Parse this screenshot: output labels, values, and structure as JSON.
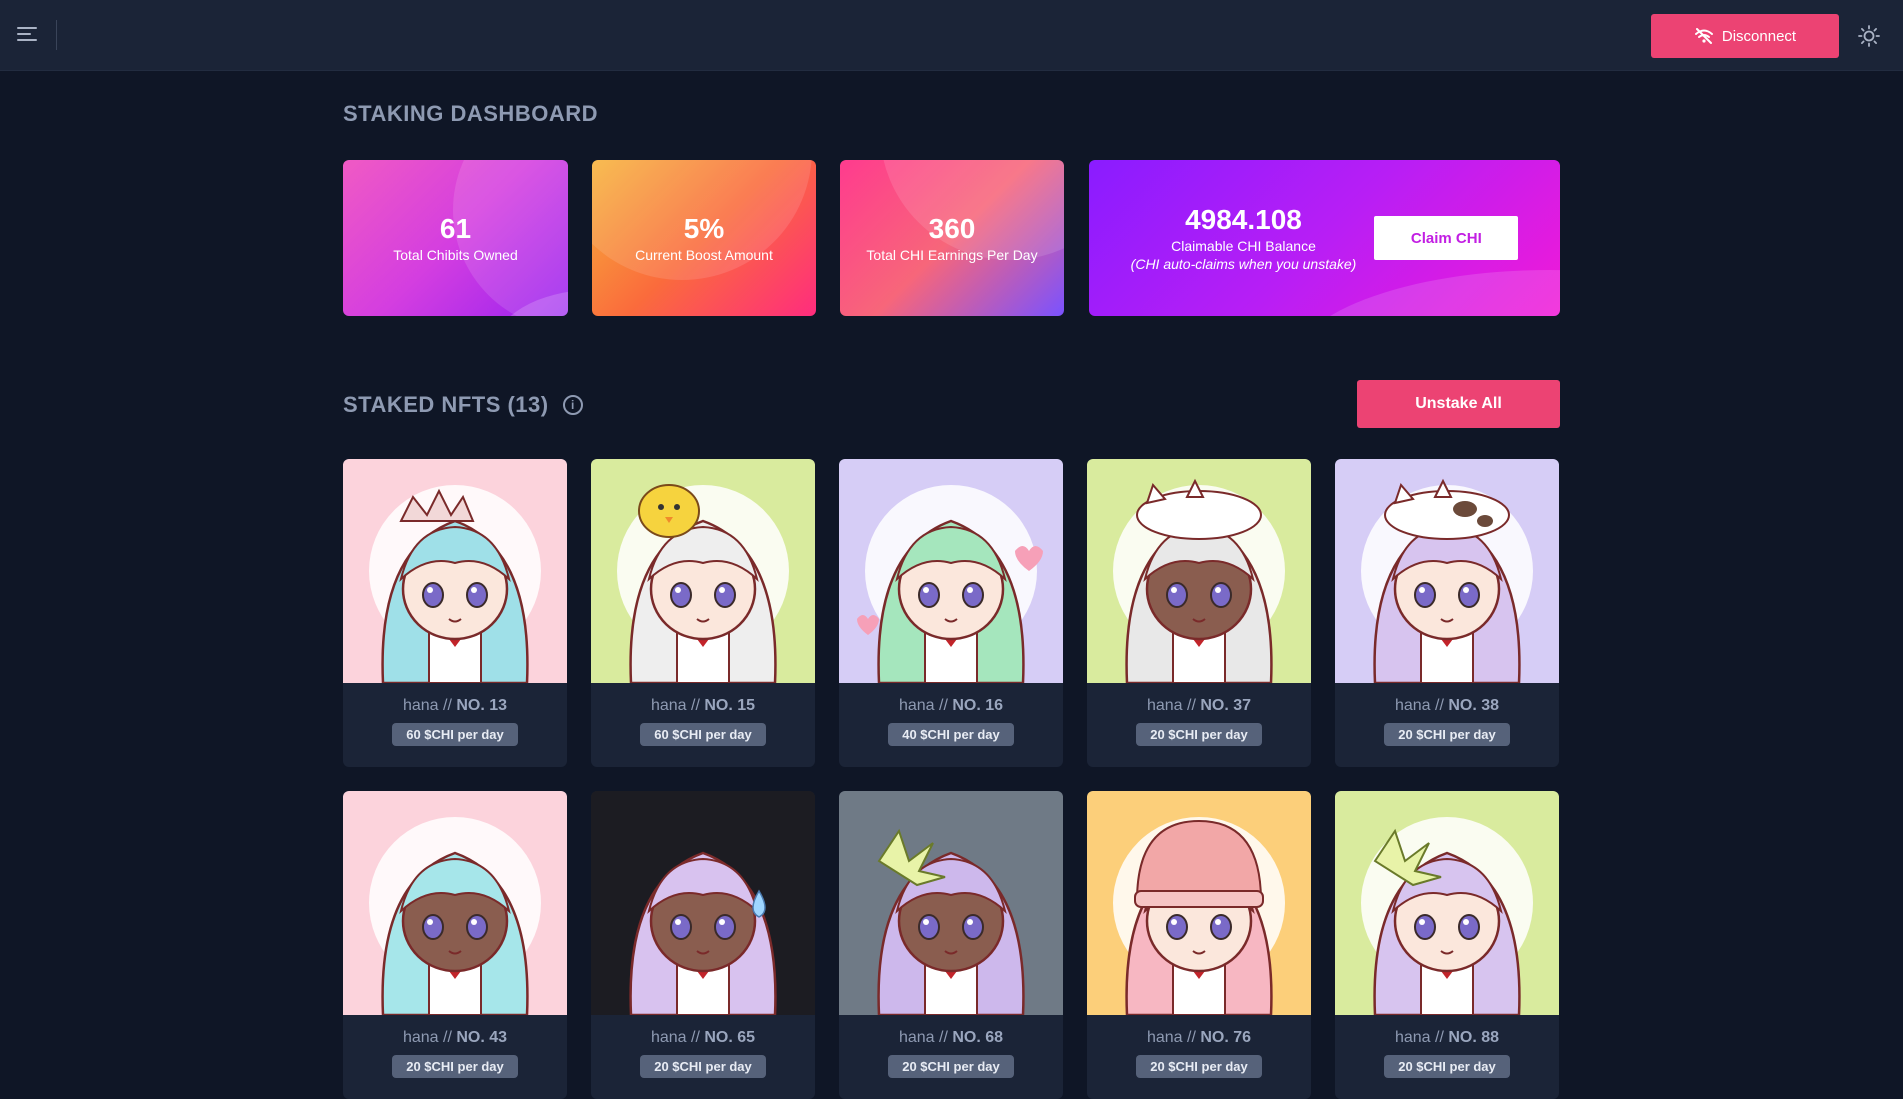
{
  "header": {
    "disconnect_label": "Disconnect",
    "accent": "#ec4373"
  },
  "dashboard": {
    "title": "STAKING DASHBOARD",
    "stats": [
      {
        "value": "61",
        "label": "Total Chibits Owned"
      },
      {
        "value": "5%",
        "label": "Current Boost Amount"
      },
      {
        "value": "360",
        "label": "Total CHI Earnings Per Day"
      }
    ],
    "claim": {
      "value": "4984.108",
      "label": "Claimable CHI Balance",
      "note": "(CHI auto-claims when you unstake)",
      "button": "Claim CHI"
    }
  },
  "staked": {
    "title": "STAKED NFTS (13)",
    "unstake_all": "Unstake All",
    "items": [
      {
        "prefix": "hana //",
        "number": "NO. 13",
        "rate": "60 $CHI per day",
        "bg": "#fcd3dc",
        "hair": "#9fe0e8",
        "skin": "#fbe7dc",
        "accessory": "crown"
      },
      {
        "prefix": "hana //",
        "number": "NO. 15",
        "rate": "60 $CHI per day",
        "bg": "#d9eb9e",
        "hair": "#eeeeee",
        "skin": "#fbe7dc",
        "accessory": "chick"
      },
      {
        "prefix": "hana //",
        "number": "NO. 16",
        "rate": "40 $CHI per day",
        "bg": "#d6cdf6",
        "hair": "#a5e6bd",
        "skin": "#fbe7dc",
        "accessory": "hearts"
      },
      {
        "prefix": "hana //",
        "number": "NO. 37",
        "rate": "20 $CHI per day",
        "bg": "#d9eb9e",
        "hair": "#e8e8e8",
        "skin": "#8a5d4f",
        "accessory": "cat"
      },
      {
        "prefix": "hana //",
        "number": "NO. 38",
        "rate": "20 $CHI per day",
        "bg": "#d6cdf6",
        "hair": "#d7c4ef",
        "skin": "#fbe7dc",
        "accessory": "cow-cat"
      },
      {
        "prefix": "hana //",
        "number": "NO. 43",
        "rate": "20 $CHI per day",
        "bg": "#fcd3dc",
        "hair": "#a6e6ea",
        "skin": "#8a5d4f",
        "accessory": "none"
      },
      {
        "prefix": "hana //",
        "number": "NO. 65",
        "rate": "20 $CHI per day",
        "bg": "#1c1c22",
        "hair": "#d8c2ef",
        "skin": "#8a5d4f",
        "accessory": "sweat"
      },
      {
        "prefix": "hana //",
        "number": "NO. 68",
        "rate": "20 $CHI per day",
        "bg": "#6f7a86",
        "hair": "#cdb8ec",
        "skin": "#8a5d4f",
        "accessory": "lily"
      },
      {
        "prefix": "hana //",
        "number": "NO. 76",
        "rate": "20 $CHI per day",
        "bg": "#fccf7a",
        "hair": "#f7b7c2",
        "skin": "#fbe7dc",
        "accessory": "beanie"
      },
      {
        "prefix": "hana //",
        "number": "NO. 88",
        "rate": "20 $CHI per day",
        "bg": "#d9eb9e",
        "hair": "#d7c4ef",
        "skin": "#fbe7dc",
        "accessory": "lily"
      }
    ]
  }
}
